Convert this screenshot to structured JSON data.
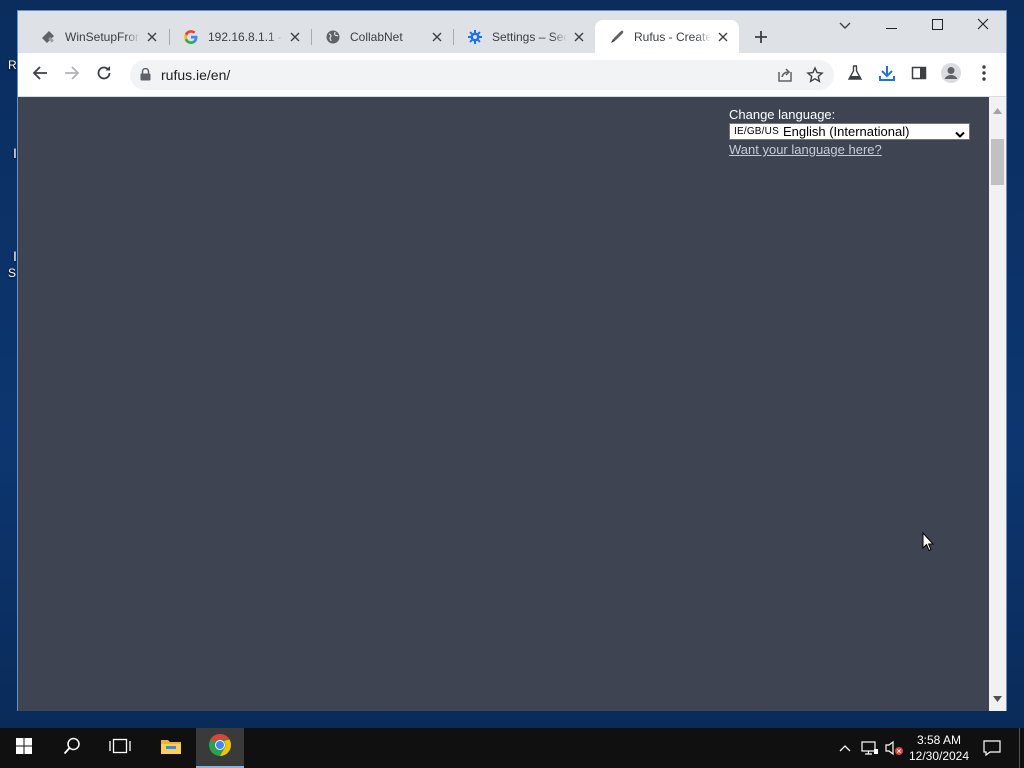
{
  "tabs": [
    {
      "title": "WinSetupFrom",
      "favicon": "usb-stick-icon",
      "active": false
    },
    {
      "title": "192.16.8.1.1 -",
      "favicon": "google-g-icon",
      "active": false
    },
    {
      "title": "CollabNet",
      "favicon": "globe-icon",
      "active": false
    },
    {
      "title": "Settings – Sec",
      "favicon": "gear-icon",
      "active": false
    },
    {
      "title": "Rufus - Create",
      "favicon": "rufus-icon",
      "active": true
    }
  ],
  "address_bar": {
    "url": "rufus.ie/en/"
  },
  "page": {
    "change_language_label": "Change language:",
    "language_flags": "IE/GB/US",
    "language_selected": "English (International)",
    "language_link": "Want your language here?"
  },
  "clock": {
    "time": "3:58 AM",
    "date": "12/30/2024"
  },
  "desktop_labels": [
    "R",
    "I",
    "I",
    "S"
  ],
  "colors": {
    "page_bg": "#3f4453",
    "tab_strip": "#dee1e6",
    "accent_blue": "#1a73e8"
  }
}
